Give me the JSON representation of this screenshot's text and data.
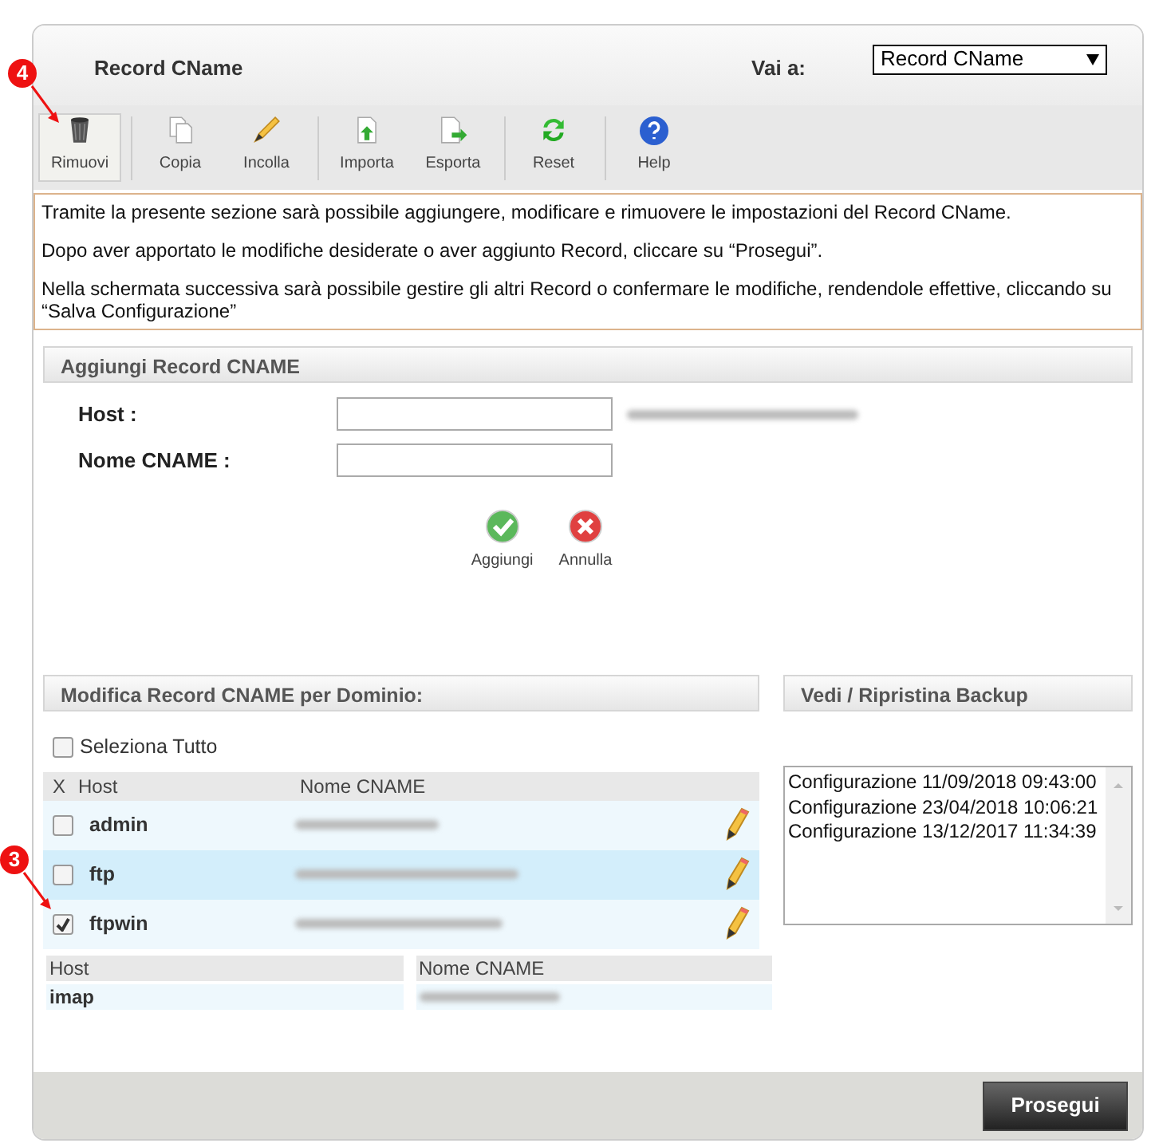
{
  "header": {
    "title": "Record CName",
    "goto_label": "Vai a:",
    "goto_value": "Record CName"
  },
  "toolbar": [
    {
      "label": "Rimuovi",
      "selected": true
    },
    {
      "label": "Copia",
      "selected": false
    },
    {
      "label": "Incolla",
      "selected": false
    },
    {
      "label": "Importa",
      "selected": false
    },
    {
      "label": "Esporta",
      "selected": false
    },
    {
      "label": "Reset",
      "selected": false
    },
    {
      "label": "Help",
      "selected": false
    }
  ],
  "info": [
    "Tramite la presente sezione sarà possibile aggiungere, modificare e rimuovere le impostazioni del Record CName.",
    "Dopo aver apportato le modifiche desiderate o aver aggiunto Record, cliccare su “Prosegui”.",
    "Nella schermata successiva sarà possibile gestire gli altri Record o confermare le modifiche, rendendole effettive, cliccando su “Salva Configurazione”"
  ],
  "add_section": {
    "title": "Aggiungi Record CNAME",
    "fields": [
      {
        "label": "Host :"
      },
      {
        "label": "Nome CNAME :"
      }
    ],
    "add_label": "Aggiungi",
    "cancel_label": "Annulla"
  },
  "edit_section": {
    "title": "Modifica Record CNAME per Dominio:",
    "select_all": {
      "label": "Seleziona Tutto",
      "checked": false
    },
    "columns": [
      "X",
      "Host",
      "Nome CNAME"
    ],
    "rows": [
      {
        "host": "admin",
        "checked": false,
        "selected": false
      },
      {
        "host": "ftp",
        "checked": false,
        "selected": true
      },
      {
        "host": "ftpwin",
        "checked": true,
        "selected": false
      }
    ],
    "other_columns": [
      "Host",
      "Nome CNAME"
    ],
    "other_rows": [
      {
        "host": "imap"
      }
    ]
  },
  "backup_section": {
    "title": "Vedi / Ripristina Backup",
    "items": [
      "Configurazione 11/09/2018 09:43:00",
      "Configurazione 23/04/2018 10:06:21",
      "Configurazione 13/12/2017 11:34:39"
    ]
  },
  "footer": {
    "button": "Prosegui"
  },
  "annotations": [
    {
      "label": "4"
    },
    {
      "label": "3"
    }
  ]
}
